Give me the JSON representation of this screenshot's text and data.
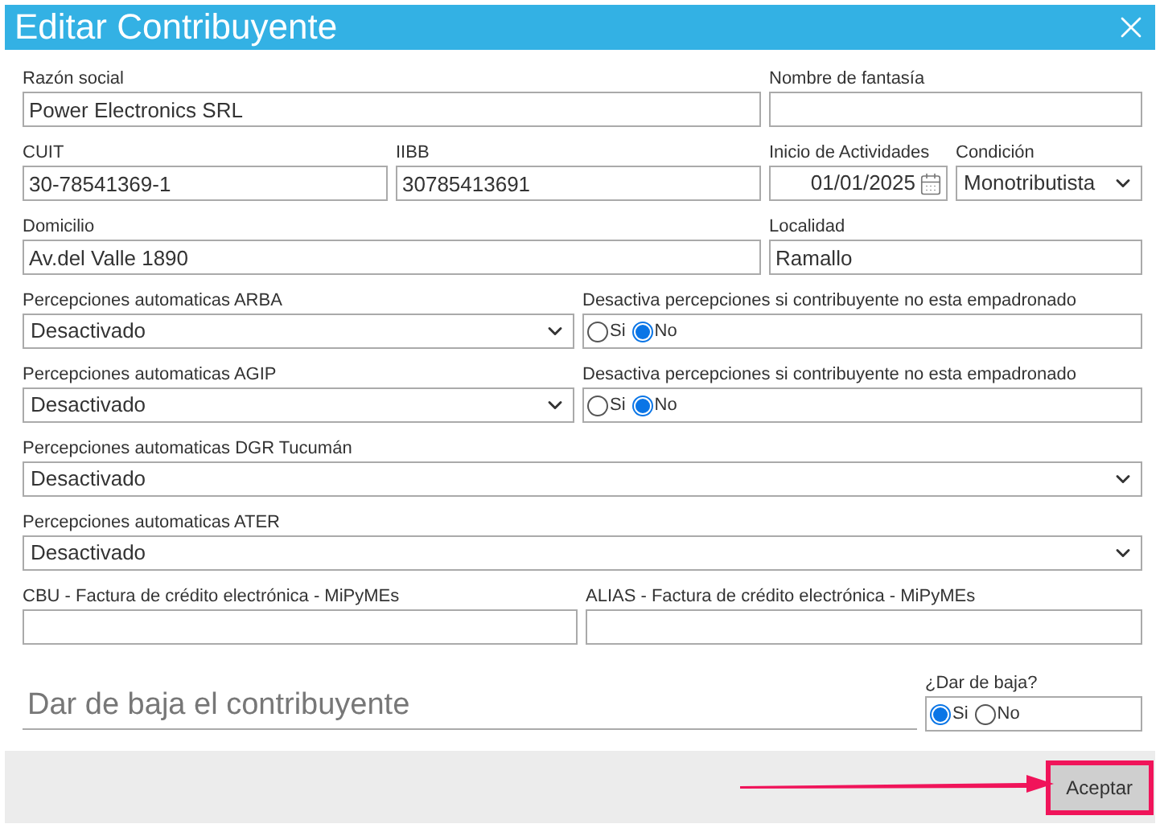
{
  "window": {
    "title": "Editar Contribuyente"
  },
  "rows": [
    {
      "fields": [
        {
          "kind": "text",
          "label": "Razón social",
          "value": "Power Electronics SRL"
        },
        {
          "kind": "text",
          "label": "Nombre de fantasía"
        }
      ]
    },
    {
      "fields": [
        {
          "kind": "text",
          "label": "CUIT",
          "value": "30-78541369-1"
        },
        {
          "kind": "text",
          "label": "IIBB",
          "value": "30785413691"
        },
        {
          "kind": "date",
          "label": "Inicio de Actividades",
          "value": "01/01/2025"
        },
        {
          "kind": "select",
          "label": "Condición",
          "value": "Monotributista"
        }
      ]
    },
    {
      "fields": [
        {
          "kind": "text",
          "label": "Domicilio",
          "value": "Av.del Valle 1890"
        },
        {
          "kind": "text",
          "label": "Localidad",
          "value": "Ramallo"
        }
      ]
    },
    {
      "fields": [
        {
          "kind": "select",
          "label": "Percepciones automaticas ARBA",
          "value": "Desactivado"
        },
        {
          "kind": "radio",
          "label": "Desactiva percepciones si contribuyente no esta empadronado",
          "options": [
            {
              "label": "Si",
              "selected": false
            },
            {
              "label": "No",
              "selected": true
            }
          ]
        }
      ]
    },
    {
      "fields": [
        {
          "kind": "select",
          "label": "Percepciones automaticas AGIP",
          "value": "Desactivado"
        },
        {
          "kind": "radio",
          "label": "Desactiva percepciones si contribuyente no esta empadronado",
          "options": [
            {
              "label": "Si",
              "selected": false
            },
            {
              "label": "No",
              "selected": true
            }
          ]
        }
      ]
    },
    {
      "fields": [
        {
          "kind": "select",
          "label": "Percepciones automaticas DGR Tucumán",
          "value": "Desactivado"
        }
      ]
    },
    {
      "fields": [
        {
          "kind": "select",
          "label": "Percepciones automaticas ATER",
          "value": "Desactivado"
        }
      ]
    },
    {
      "fields": [
        {
          "kind": "text",
          "label": "CBU - Factura de crédito electrónica - MiPyMEs"
        },
        {
          "kind": "text",
          "label": "ALIAS - Factura de crédito electrónica - MiPyMEs"
        }
      ]
    },
    {
      "fields": [
        {
          "kind": "underline",
          "placeholder": "Dar de baja el contribuyente"
        },
        {
          "kind": "radio",
          "label": "¿Dar de baja?",
          "options": [
            {
              "label": "Si",
              "selected": true
            },
            {
              "label": "No",
              "selected": false
            }
          ]
        }
      ]
    }
  ],
  "footer": {
    "button": "Aceptar",
    "highlighted": true
  }
}
